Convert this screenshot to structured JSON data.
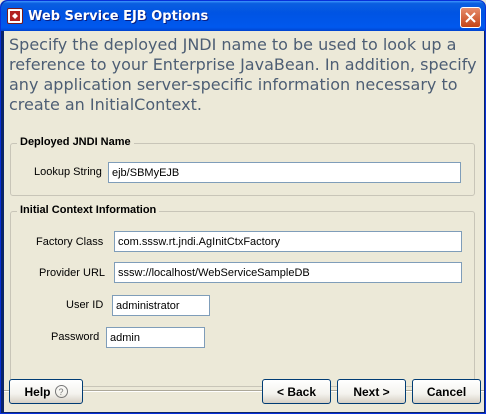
{
  "window": {
    "title": "Web Service EJB Options"
  },
  "instructions": "Specify the deployed JNDI name to be used to look up a reference to your Enterprise JavaBean. In addition, specify any application server-specific information necessary to create an InitialContext.",
  "jndi_group": {
    "legend": "Deployed JNDI Name",
    "lookup_label": "Lookup String",
    "lookup_value": "ejb/SBMyEJB"
  },
  "context_group": {
    "legend": "Initial Context Information",
    "factory_label": "Factory Class",
    "factory_value": "com.sssw.rt.jndi.AgInitCtxFactory",
    "provider_label": "Provider URL",
    "provider_value": "sssw://localhost/WebServiceSampleDB",
    "user_label": "User ID",
    "user_value": "administrator",
    "password_label": "Password",
    "password_value": "admin"
  },
  "buttons": {
    "help": "Help",
    "back": "< Back",
    "next": "Next >",
    "cancel": "Cancel"
  },
  "icons": {
    "app": "app-icon",
    "close": "close-icon",
    "help": "help-icon"
  },
  "colors": {
    "titlebar": "#0054e3",
    "instruction_text": "#4d5e74",
    "dialog_bg": "#ece9d8"
  }
}
